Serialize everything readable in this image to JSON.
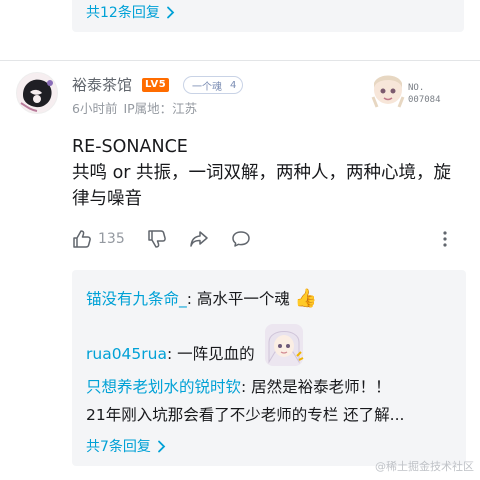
{
  "previous_reply": {
    "more_label": "共12条回复"
  },
  "comment": {
    "username": "裕泰茶馆",
    "level_badge": "LV5",
    "fan_badge": {
      "name": "一个魂",
      "level": "4"
    },
    "time": "6小时前",
    "ip_location": "IP属地：江苏",
    "decoration_no": {
      "label": "NO.",
      "number": "007084"
    },
    "content_lines": [
      "RE-SONANCE",
      "共鸣 or 共振，一词双解，两种人，两种心境，旋",
      "律与噪音"
    ],
    "like_count": "135",
    "colors": {
      "link": "#00a1d6",
      "level_badge": "#ff6c00",
      "meta": "#9499a0"
    }
  },
  "replies": [
    {
      "name": "锚没有九条命_",
      "text": ": 高水平一个魂",
      "emoji": "👍"
    },
    {
      "name": "rua045rua",
      "text": ": 一阵见血的",
      "sticker": "anime-girl-sticker"
    },
    {
      "name": "只想养老划水的锐时钦",
      "text": ": 居然是裕泰老师！！"
    },
    {
      "name": "",
      "text": "21年刚入坑那会看了不少老师的专栏 还了解..."
    }
  ],
  "replies_more_label": "共7条回复",
  "watermark": "@稀土掘金技术社区"
}
